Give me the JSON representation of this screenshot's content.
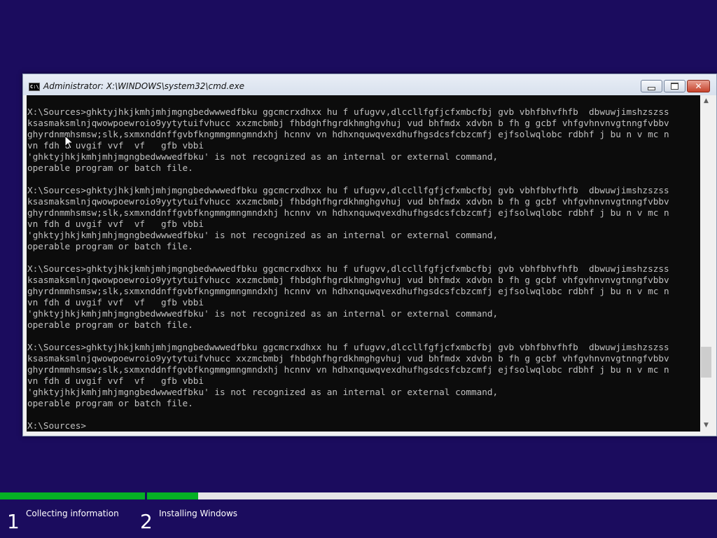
{
  "window": {
    "title": "Administrator: X:\\WINDOWS\\system32\\cmd.exe",
    "icon": "cmd-icon",
    "controls": {
      "minimize": "minimize-icon",
      "maximize": "maximize-icon",
      "close": "close-icon"
    }
  },
  "console": {
    "lines": [
      "X:\\Sources>ghktyjhkjkmhjmhjmgngbedwwwedfbku ggcmcrxdhxx hu f ufugvv,dlccllfgfjcfxmbcfbj gvb vbhfbhvfhfb  dbwuwjimshzszss",
      "ksasmaksmlnjqwowpoewroio9yytytuifvhucc xxzmcbmbj fhbdghfhgrdkhmghgvhuj vud bhfmdx xdvbn b fh g gcbf vhfgvhnvnvgtnngfvbbv",
      "ghyrdnmmhsmsw;slk,sxmxnddnffgvbfkngmmgmngmndxhj hcnnv vn hdhxnquwqvexdhufhgsdcsfcbzcmfj ejfsolwqlobc rdbhf j bu n v mc n",
      "vn fdh d uvgif vvf  vf   gfb vbbi",
      "'ghktyjhkjkmhjmhjmgngbedwwwedfbku' is not recognized as an internal or external command,",
      "operable program or batch file.",
      "",
      "X:\\Sources>ghktyjhkjkmhjmhjmgngbedwwwedfbku ggcmcrxdhxx hu f ufugvv,dlccllfgfjcfxmbcfbj gvb vbhfbhvfhfb  dbwuwjimshzszss",
      "ksasmaksmlnjqwowpoewroio9yytytuifvhucc xxzmcbmbj fhbdghfhgrdkhmghgvhuj vud bhfmdx xdvbn b fh g gcbf vhfgvhnvnvgtnngfvbbv",
      "ghyrdnmmhsmsw;slk,sxmxnddnffgvbfkngmmgmngmndxhj hcnnv vn hdhxnquwqvexdhufhgsdcsfcbzcmfj ejfsolwqlobc rdbhf j bu n v mc n",
      "vn fdh d uvgif vvf  vf   gfb vbbi",
      "'ghktyjhkjkmhjmhjmgngbedwwwedfbku' is not recognized as an internal or external command,",
      "operable program or batch file.",
      "",
      "X:\\Sources>ghktyjhkjkmhjmhjmgngbedwwwedfbku ggcmcrxdhxx hu f ufugvv,dlccllfgfjcfxmbcfbj gvb vbhfbhvfhfb  dbwuwjimshzszss",
      "ksasmaksmlnjqwowpoewroio9yytytuifvhucc xxzmcbmbj fhbdghfhgrdkhmghgvhuj vud bhfmdx xdvbn b fh g gcbf vhfgvhnvnvgtnngfvbbv",
      "ghyrdnmmhsmsw;slk,sxmxnddnffgvbfkngmmgmngmndxhj hcnnv vn hdhxnquwqvexdhufhgsdcsfcbzcmfj ejfsolwqlobc rdbhf j bu n v mc n",
      "vn fdh d uvgif vvf  vf   gfb vbbi",
      "'ghktyjhkjkmhjmhjmgngbedwwwedfbku' is not recognized as an internal or external command,",
      "operable program or batch file.",
      "",
      "X:\\Sources>ghktyjhkjkmhjmhjmgngbedwwwedfbku ggcmcrxdhxx hu f ufugvv,dlccllfgfjcfxmbcfbj gvb vbhfbhvfhfb  dbwuwjimshzszss",
      "ksasmaksmlnjqwowpoewroio9yytytuifvhucc xxzmcbmbj fhbdghfhgrdkhmghgvhuj vud bhfmdx xdvbn b fh g gcbf vhfgvhnvnvgtnngfvbbv",
      "ghyrdnmmhsmsw;slk,sxmxnddnffgvbfkngmmgmngmndxhj hcnnv vn hdhxnquwqvexdhufhgsdcsfcbzcmfj ejfsolwqlobc rdbhf j bu n v mc n",
      "vn fdh d uvgif vvf  vf   gfb vbbi",
      "'ghktyjhkjkmhjmhjmgngbedwwwedfbku' is not recognized as an internal or external command,",
      "operable program or batch file.",
      "",
      "X:\\Sources>"
    ],
    "scroll_position": 0.85
  },
  "setup_progress": {
    "steps": [
      {
        "number": "1",
        "label": "Collecting information",
        "progress": 1.0
      },
      {
        "number": "2",
        "label": "Installing Windows",
        "progress": 0.09
      }
    ]
  },
  "colors": {
    "background": "#1b0c5e",
    "console_bg": "#0c0c0c",
    "console_text": "#c0c0c0",
    "progress_fill": "#06b025",
    "progress_track": "#e6e6e6"
  }
}
